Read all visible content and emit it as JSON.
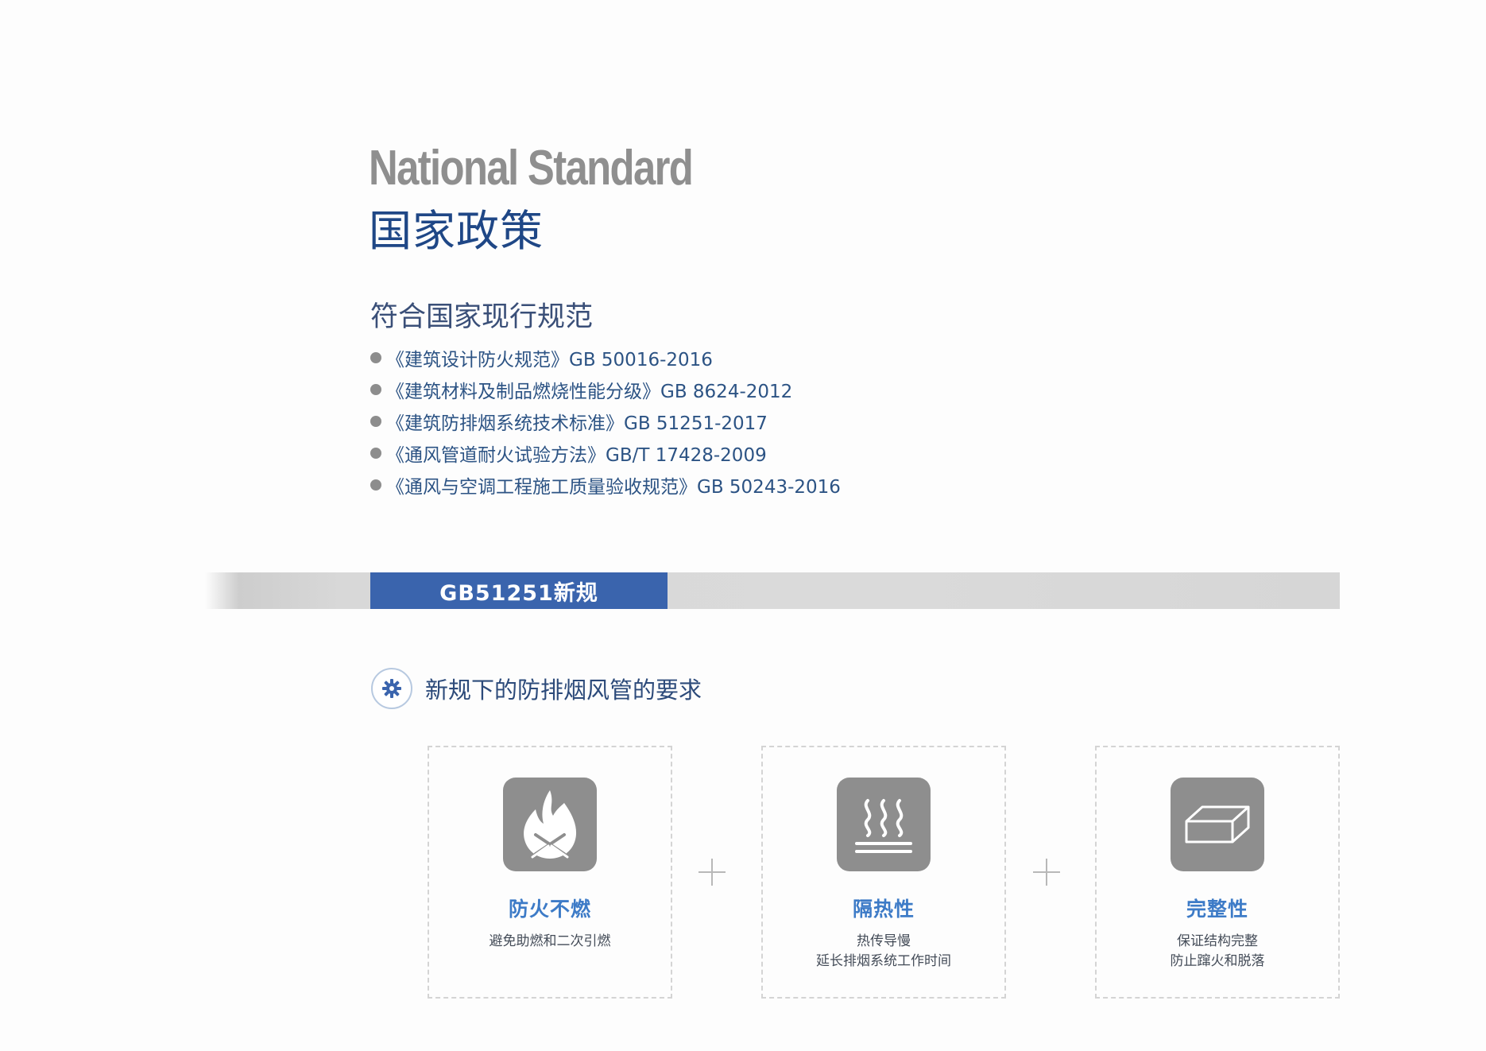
{
  "header": {
    "title_en": "National Standard",
    "title_cn": "国家政策"
  },
  "standards": {
    "heading": "符合国家现行规范",
    "items": [
      "《建筑设计防火规范》GB 50016-2016",
      "《建筑材料及制品燃烧性能分级》GB 8624-2012",
      "《建筑防排烟系统技术标准》GB 51251-2017",
      "《通风管道耐火试验方法》GB/T 17428-2009",
      "《通风与空调工程施工质量验收规范》GB  50243-2016"
    ]
  },
  "banner": {
    "label": "GB51251新规"
  },
  "requirements": {
    "heading": "新规下的防排烟风管的要求",
    "heading_icon": "gear-icon",
    "cards": [
      {
        "icon": "flame-icon",
        "title": "防火不燃",
        "desc_lines": [
          "避免助燃和二次引燃"
        ]
      },
      {
        "icon": "heat-icon",
        "title": "隔热性",
        "desc_lines": [
          "热传导慢",
          "延长排烟系统工作时间"
        ]
      },
      {
        "icon": "block-icon",
        "title": "完整性",
        "desc_lines": [
          "保证结构完整",
          "防止蹿火和脱落"
        ]
      }
    ]
  },
  "colors": {
    "title_blue": "#1f4786",
    "accent_blue": "#3a64ad",
    "card_title_blue": "#3d7bc7",
    "icon_gray": "#8e8e8e",
    "title_gray": "#8f8f8f"
  }
}
